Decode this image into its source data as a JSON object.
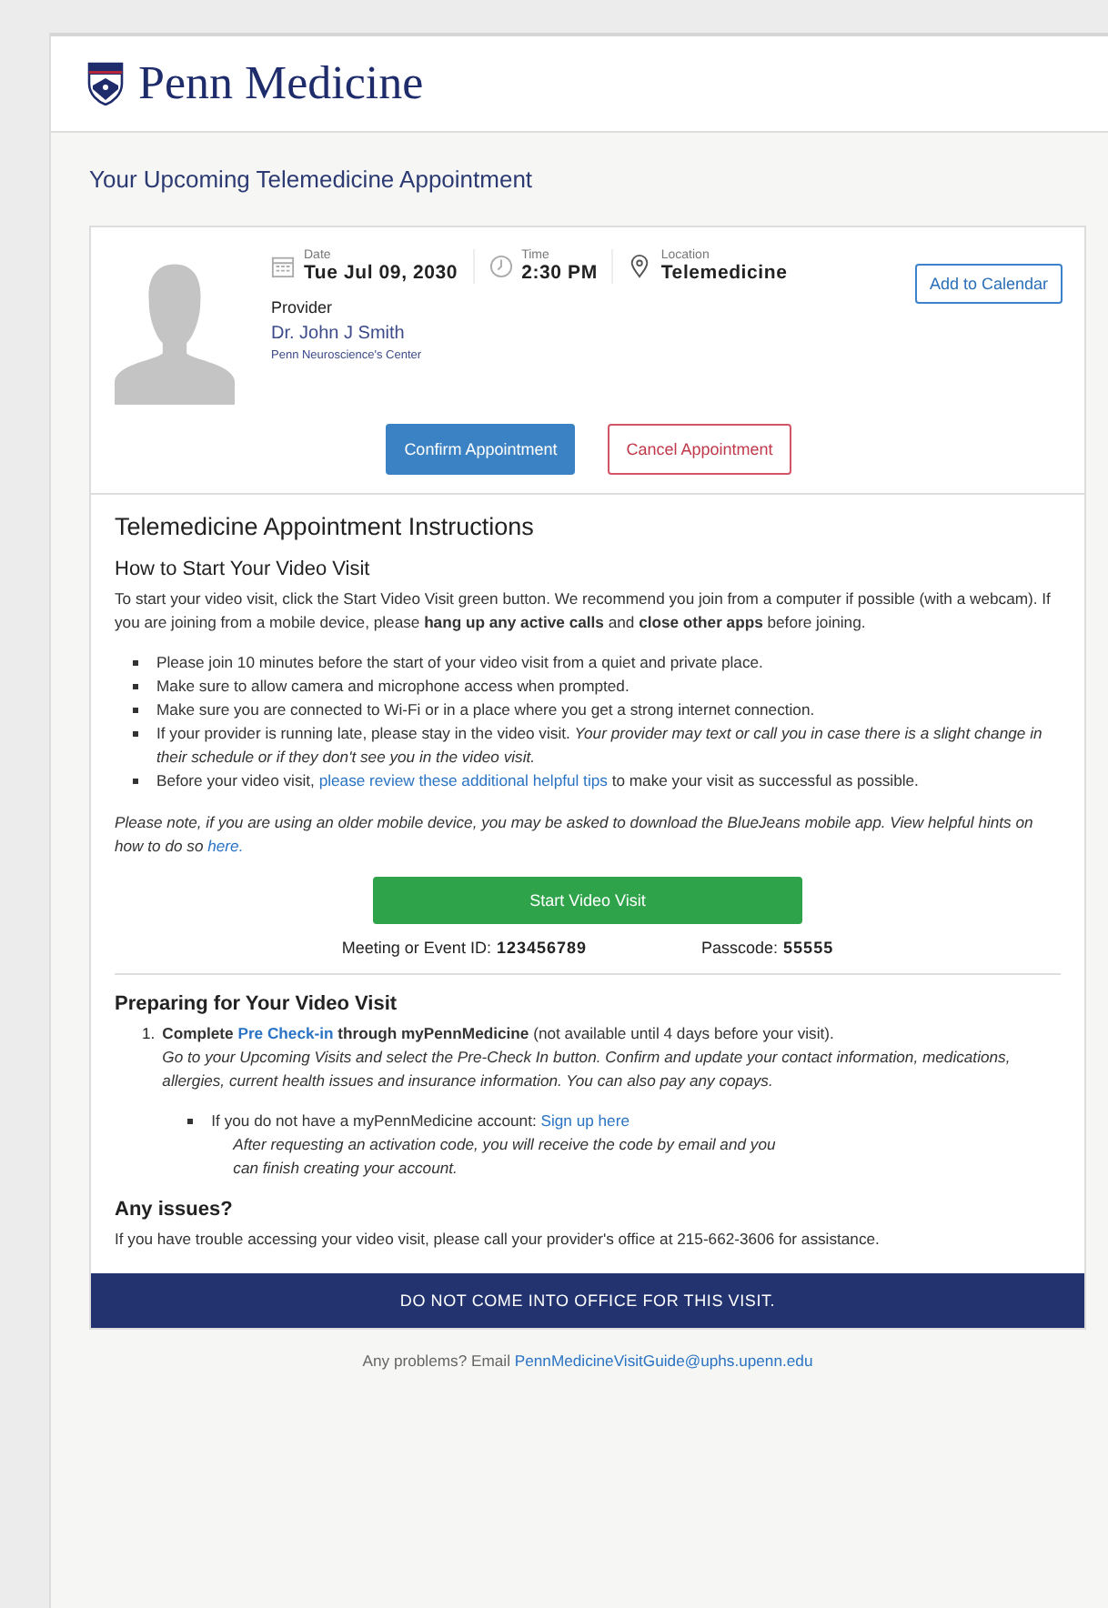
{
  "header": {
    "logo_text": "Penn Medicine"
  },
  "page_title": "Your Upcoming Telemedicine Appointment",
  "appointment": {
    "details": [
      {
        "kind": "date",
        "label": "Date",
        "value": "Tue Jul 09, 2030"
      },
      {
        "kind": "time",
        "label": "Time",
        "value": "2:30 PM"
      },
      {
        "kind": "location",
        "label": "Location",
        "value": "Telemedicine"
      }
    ],
    "add_to_calendar": "Add to Calendar",
    "provider_label": "Provider",
    "provider_name": "Dr. John J Smith",
    "provider_center": "Penn Neuroscience's Center",
    "buttons": [
      {
        "kind": "primary",
        "label": "Confirm Appointment"
      },
      {
        "kind": "danger",
        "label": "Cancel Appointment"
      }
    ]
  },
  "instructions": {
    "title": "Telemedicine Appointment Instructions",
    "how_to_heading": "How to Start Your Video Visit",
    "intro": "To start your video visit, click the Start Video Visit green button. We recommend you join from a computer if possible (with a webcam). If you are joining from a mobile device, please **hang up any active calls** and **close other apps** before joining.",
    "bullets": [
      [
        {
          "kind": "text",
          "text": "Please join 10 minutes before the start of your video visit from a quiet and private place."
        }
      ],
      [
        {
          "kind": "text",
          "text": "Make sure to allow camera and microphone access when prompted."
        }
      ],
      [
        {
          "kind": "text",
          "text": "Make sure you are connected to Wi-Fi or in a place where you get a strong internet connection."
        }
      ],
      [
        {
          "kind": "text",
          "text": "If your provider is running late, please stay in the video visit. *Your provider may text or call you in case there is a slight change in their schedule or if they don't see you in the video visit.*"
        }
      ],
      [
        {
          "kind": "text",
          "text": "Before your video visit, "
        },
        {
          "kind": "link",
          "text": "please review these additional helpful tips"
        },
        {
          "kind": "text",
          "text": " to make your visit as successful as possible."
        }
      ]
    ],
    "note": [
      {
        "kind": "text",
        "text": "Please note, if you are using an older mobile device, you may be asked to download the BlueJeans mobile app. View helpful hints on how to do so "
      },
      {
        "kind": "link",
        "text": "here."
      }
    ],
    "start_button": "Start Video Visit",
    "meeting_label": "Meeting or Event ID:",
    "meeting_id": "123456789",
    "passcode_label": "Passcode:",
    "passcode": "55555",
    "preparing_heading": "Preparing for Your Video Visit",
    "steps": [
      {
        "number": "1.",
        "line": [
          {
            "kind": "bold",
            "text": "Complete "
          },
          {
            "kind": "link",
            "text": "Pre Check-in"
          },
          {
            "kind": "bold",
            "text": " through myPennMedicine"
          },
          {
            "kind": "text",
            "text": " (not available until 4 days before your visit)."
          }
        ],
        "detail": "Go to your Upcoming Visits and select the Pre-Check In button. Confirm and update your contact information, medications, allergies, current health issues and insurance information. You can also pay any copays.",
        "sub": [
          {
            "line": [
              {
                "kind": "text",
                "text": "If you do not have a myPennMedicine account: "
              },
              {
                "kind": "link",
                "text": "Sign up here"
              }
            ],
            "detail": "After requesting an activation code, you will receive the code by email and you can finish creating your account."
          }
        ]
      }
    ],
    "issues_heading": "Any issues?",
    "issues_text": "If you have trouble accessing your video visit, please call your provider's office at 215-662-3606 for assistance."
  },
  "banner": "DO NOT COME INTO OFFICE FOR THIS VISIT.",
  "footer": {
    "text": "Any problems? Email",
    "email": "PennMedicineVisitGuide@uphs.upenn.edu"
  }
}
